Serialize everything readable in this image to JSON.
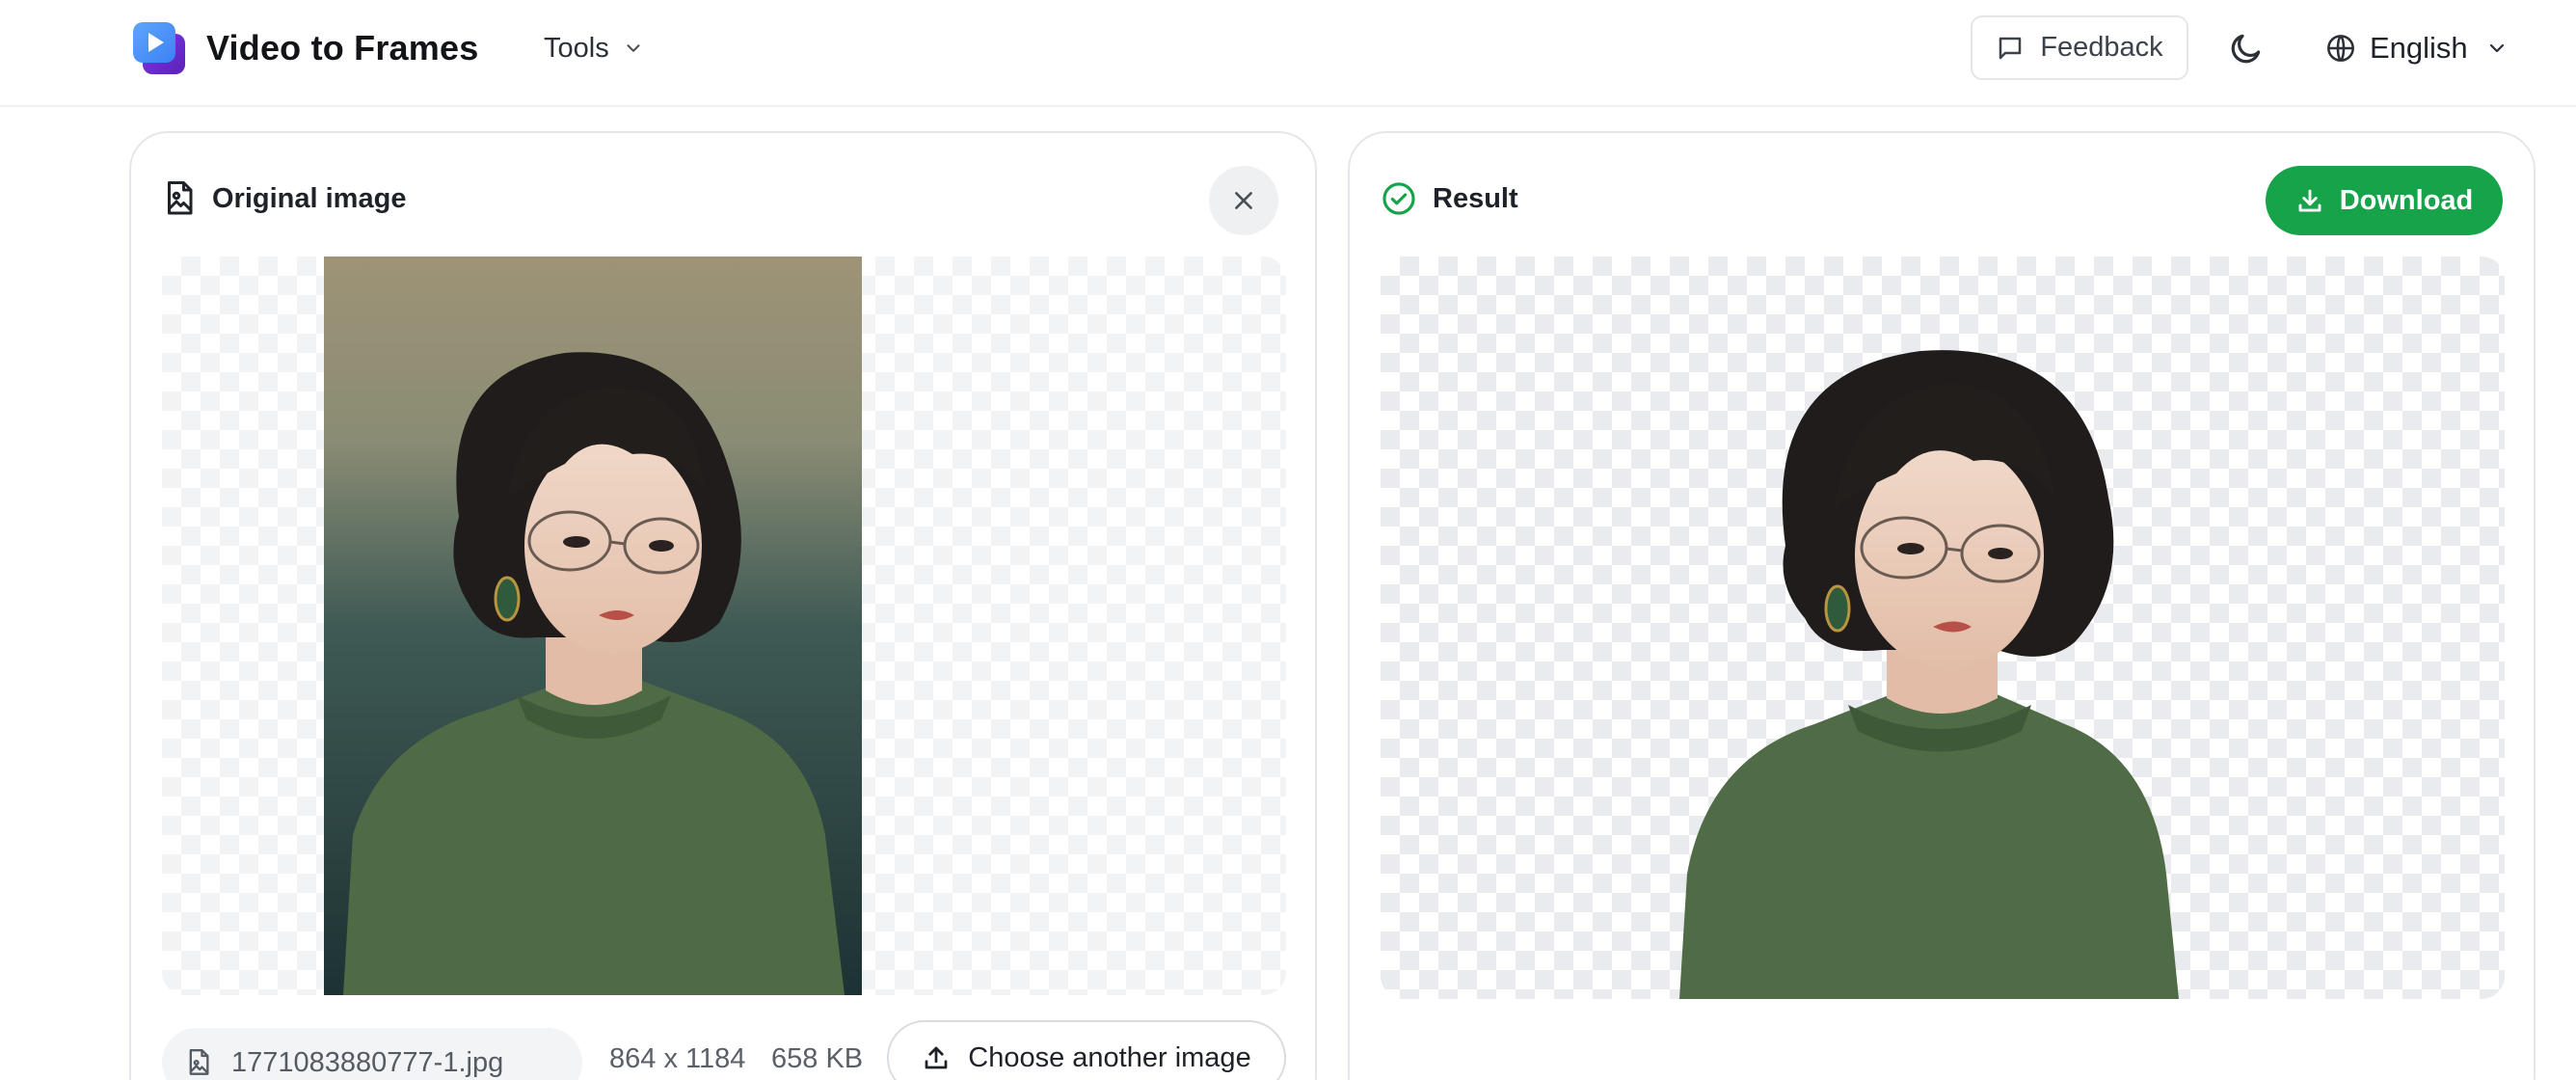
{
  "app": {
    "title": "Video to Frames"
  },
  "nav": {
    "tools_label": "Tools"
  },
  "header": {
    "feedback_label": "Feedback",
    "language_label": "English"
  },
  "original_panel": {
    "title": "Original image",
    "file_name": "1771083880777-1.jpg",
    "dimensions": "864 x 1184",
    "file_size": "658 KB",
    "choose_label": "Choose another image"
  },
  "result_panel": {
    "title": "Result",
    "download_label": "Download"
  },
  "colors": {
    "accent_green": "#17a34a",
    "logo_blue": "#3b82f6",
    "logo_purple": "#7c3aed",
    "border": "#e4e6ea"
  }
}
